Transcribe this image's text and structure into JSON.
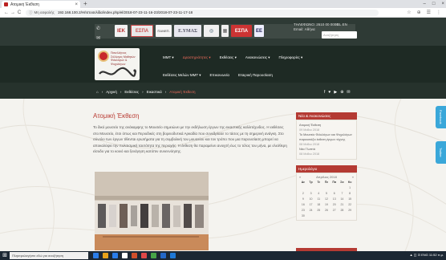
{
  "browser": {
    "tab_title": "Ατομική Έκθεση",
    "tab_close": "×",
    "new_tab": "+",
    "window_controls": [
      "–",
      "□",
      "×"
    ],
    "nav": [
      "←",
      "→",
      "C"
    ],
    "security_label": "Μη ασφαλής",
    "url": "192.168.100.2/Η/Ιστοσελίδα/index.php/el/2018-07-23-11-16-23/2018-07-23-11-17-18",
    "toolbar_icons": [
      "☆",
      "⊕",
      "☰",
      "⋮"
    ]
  },
  "header": {
    "partners": [
      "ΙΕΚ",
      "ΕΣΠΑ",
      "ΠΑΝΕΠ.",
      "Ε.ΥΜΑΣ",
      "◎",
      "▦",
      "ΕΣΠΑ",
      "ΕΕ"
    ],
    "contact": [
      "ΤΗΛΕΦΩΝΟ: 2610 00 0000",
      "Email: Αθήνα"
    ],
    "language": "EL  EN",
    "search_placeholder": "Αναζήτηση"
  },
  "logo": {
    "text": "Πανελλήνιος Σύλλογος Μαθητών Φιλολόγων & Ψυχολόγων"
  },
  "menu": {
    "items": [
      "ΜΜΤ ▾",
      "Δραστηριότητες ▾",
      "Εκθέσεις ▾",
      "Ανακοινώσεις ▾",
      "Πληροφορίες ▾"
    ],
    "items2": [
      "Εκθέσεις Μελών ΜΜΤ ▾",
      "Επικοινωνία",
      "Εταιρική Παρουσίαση"
    ]
  },
  "breadcrumb": {
    "home_icon": "⌂",
    "items": [
      "Αρχική",
      "Εκθέσεις",
      "Εικαστικά"
    ],
    "current": "Ατομική Έκθεση",
    "separator": "›"
  },
  "social": [
    "f",
    "♥",
    "▶",
    "⊕",
    "✉"
  ],
  "main": {
    "title": "Ατομική Έκθεση",
    "intro": "Το δικό μουσείο της ανάκαμψης το Μουσείο σημειώνει με την εκδήλωση έργων της εικαστικής καλλιτέχνιδος. Η εκθέσεις στο Μουσείο, έτσι όπως και Περιοδικές στη βορειοδυτικά Αρκαδία που συνεδρίασε το τάσος με τη σημερινή ανάγκη. Στο σύνολο των έργων τίθενται ερωτήματα για τη συμβολική του μουσείου και τον τρόπο που μια παρουσίαση μπορεί να αποκαλύψει την πολιτισμική ταυτότητα της περιοχής. Η έκθεση θα παραμείνει ανοιχτή έως το τέλος του μήνα, με ελεύθερη είσοδο για το κοινό και ξενάγηση κατόπιν συνεννόησης."
  },
  "sidebar": {
    "news_title": "Νέα & Ανακοινώσεις",
    "news": [
      {
        "title": "Ατομική Έκθεση",
        "date": "09 Μαΐου 2018"
      },
      {
        "title": "Το Μουσείο Φιλολόγων και Ψυχολόγων παρουσιάζει έκθεση έργων τέχνης",
        "date": "08 Μαΐου 2018"
      },
      {
        "title": "Νέα Γλυπτά",
        "date": "08 Μαΐου 2018"
      }
    ],
    "calendar_title": "Ημερολόγιο",
    "calendar": {
      "prev": "«",
      "month": "Απρίλιος 2018",
      "next": "»",
      "weekdays": [
        "Δε",
        "Τρ",
        "Τε",
        "Πε",
        "Πα",
        "Σα",
        "Κυ"
      ],
      "days": [
        "",
        "",
        "",
        "",
        "",
        "",
        "1",
        "2",
        "3",
        "4",
        "5",
        "6",
        "7",
        "8",
        "9",
        "10",
        "11",
        "12",
        "13",
        "14",
        "15",
        "16",
        "17",
        "18",
        "19",
        "20",
        "21",
        "22",
        "23",
        "24",
        "25",
        "26",
        "27",
        "28",
        "29",
        "30"
      ]
    }
  },
  "side_tabs": [
    "Facebook",
    "Twitter"
  ],
  "taskbar": {
    "start": "⊞",
    "search": "Πληκτρολογήστε εδώ για αναζήτηση",
    "apps": [
      "#2b7de9",
      "#e7a21b",
      "#2b7de9",
      "#ffffff",
      "#d04f2b",
      "#e04848",
      "#47a447",
      "#2468c8",
      "#1e78d7"
    ],
    "tray": "▲ ◫ ⊡ ENG  11:52 π.μ."
  }
}
